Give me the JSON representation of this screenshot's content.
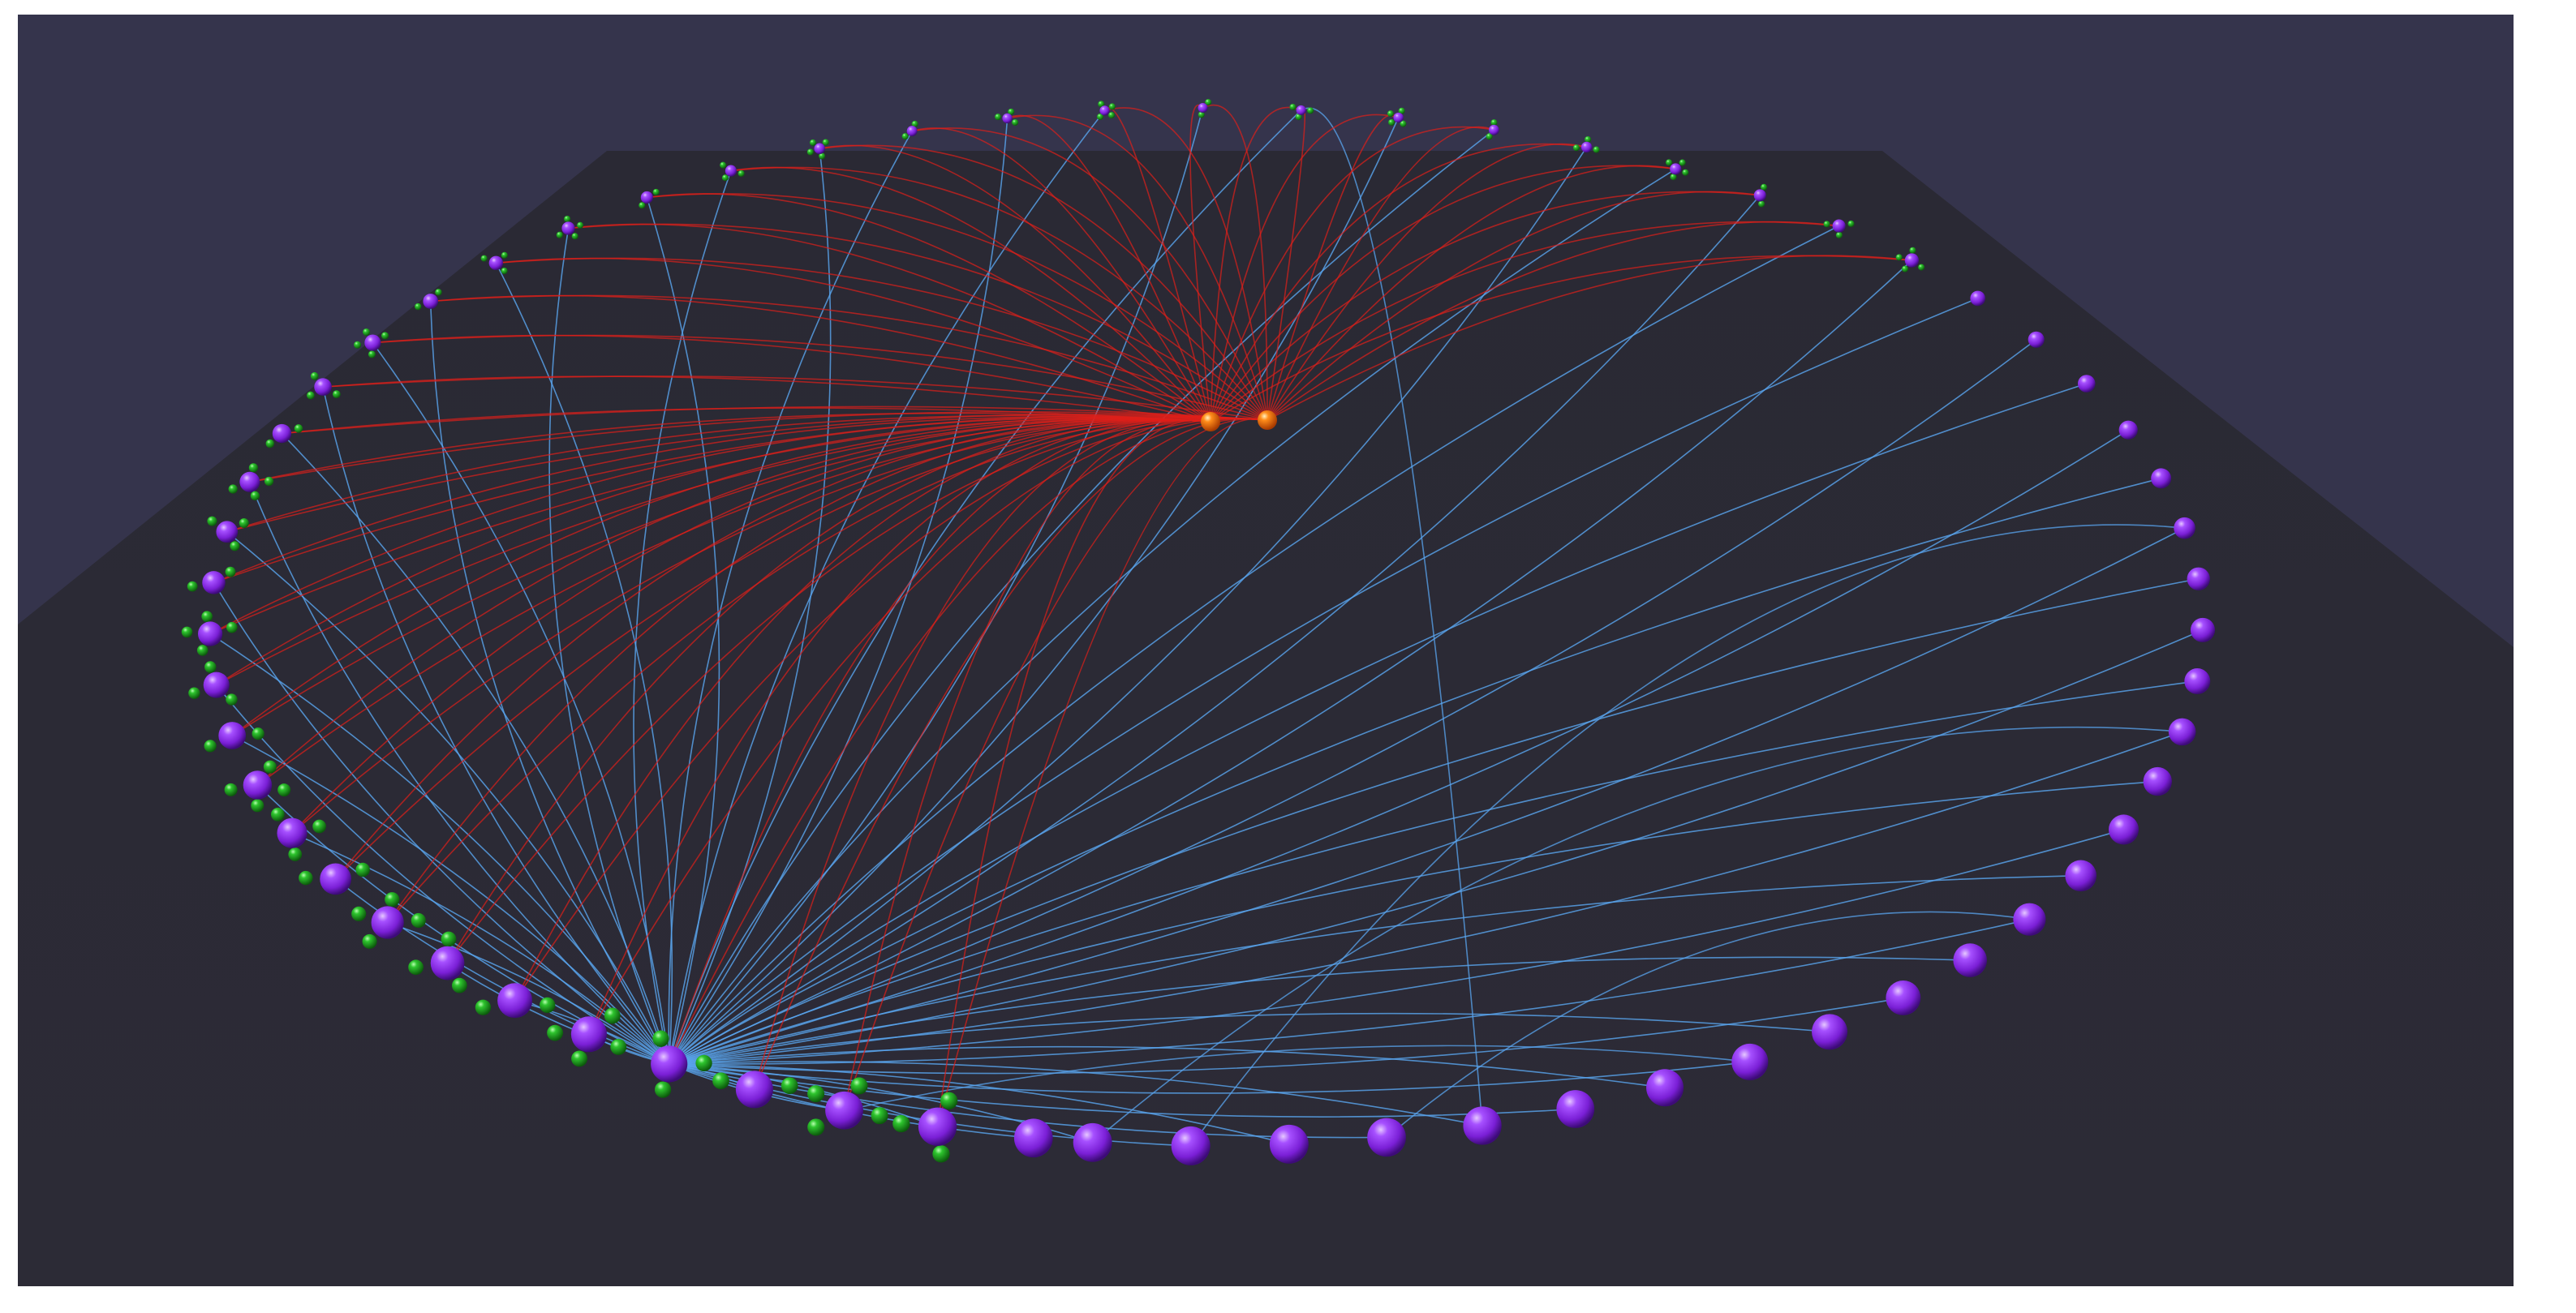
{
  "scene": {
    "kind": "3d-network-graph",
    "colors": {
      "background": "#35344c",
      "floor": "#2b2a35",
      "node_primary": "#8a2be2",
      "node_leaf": "#1fa81f",
      "node_hub": "#ff7a00",
      "edge_hub": "#e0201a",
      "edge_anchor": "#5aa6f0"
    },
    "ring": {
      "node_count": 64,
      "hub_linked_count": 38
    },
    "hub_count": 2,
    "anchor_node_index": 4
  }
}
